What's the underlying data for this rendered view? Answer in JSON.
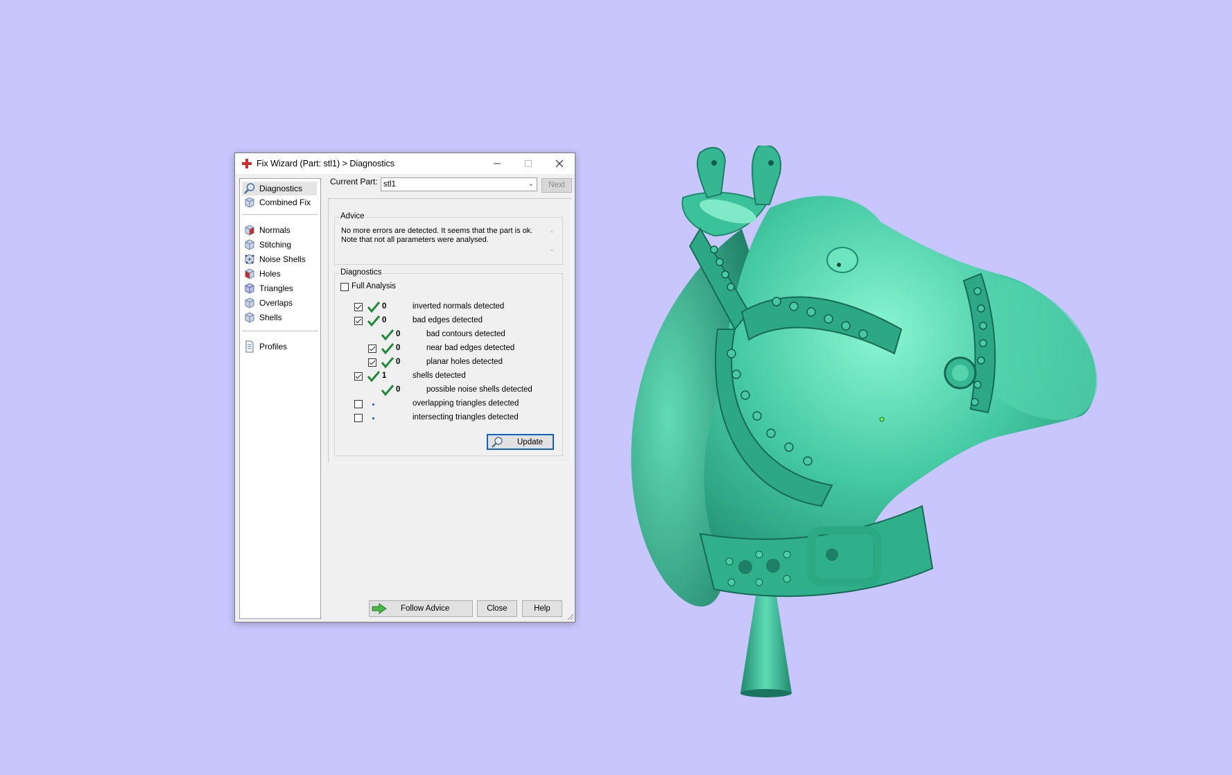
{
  "window": {
    "title": "Fix Wizard (Part: stl1) > Diagnostics"
  },
  "nav": {
    "items": [
      {
        "label": "Diagnostics",
        "icon": "magnifier-icon"
      },
      {
        "label": "Combined Fix",
        "icon": "cube-icon"
      },
      {
        "label": "Normals",
        "icon": "cube-red-icon"
      },
      {
        "label": "Stitching",
        "icon": "cube-icon"
      },
      {
        "label": "Noise Shells",
        "icon": "noise-shells-icon"
      },
      {
        "label": "Holes",
        "icon": "cube-red-icon"
      },
      {
        "label": "Triangles",
        "icon": "cube-icon"
      },
      {
        "label": "Overlaps",
        "icon": "cube-icon"
      },
      {
        "label": "Shells",
        "icon": "cube-icon"
      },
      {
        "label": "Profiles",
        "icon": "document-icon"
      }
    ]
  },
  "current_part": {
    "label": "Current Part:",
    "value": "stl1",
    "next_label": "Next"
  },
  "advice": {
    "legend": "Advice",
    "line1": "No more errors are detected. It seems that the part is ok.",
    "line2": "Note that not all parameters were analysed."
  },
  "diagnostics": {
    "legend": "Diagnostics",
    "full_analysis_label": "Full Analysis",
    "rows": [
      {
        "checked": true,
        "ok": true,
        "count": "0",
        "label": "inverted normals detected"
      },
      {
        "checked": true,
        "ok": true,
        "count": "0",
        "label": "bad edges detected"
      },
      {
        "checked": null,
        "ok": true,
        "count": "0",
        "label": "bad contours detected"
      },
      {
        "checked": true,
        "ok": true,
        "count": "0",
        "label": "near bad edges detected"
      },
      {
        "checked": true,
        "ok": true,
        "count": "0",
        "label": "planar holes detected"
      },
      {
        "checked": true,
        "ok": true,
        "count": "1",
        "label": "shells detected"
      },
      {
        "checked": null,
        "ok": true,
        "count": "0",
        "label": "possible noise shells detected"
      },
      {
        "checked": false,
        "ok": false,
        "count": "",
        "label": "overlapping triangles detected"
      },
      {
        "checked": false,
        "ok": false,
        "count": "",
        "label": "intersecting triangles detected"
      }
    ],
    "update_label": "Update"
  },
  "footer": {
    "follow_advice_label": "Follow Advice",
    "close_label": "Close",
    "help_label": "Help"
  },
  "colors": {
    "background": "#c8c6fc",
    "model": "#3fbf9a",
    "ok_tick": "#1e8a3a"
  }
}
